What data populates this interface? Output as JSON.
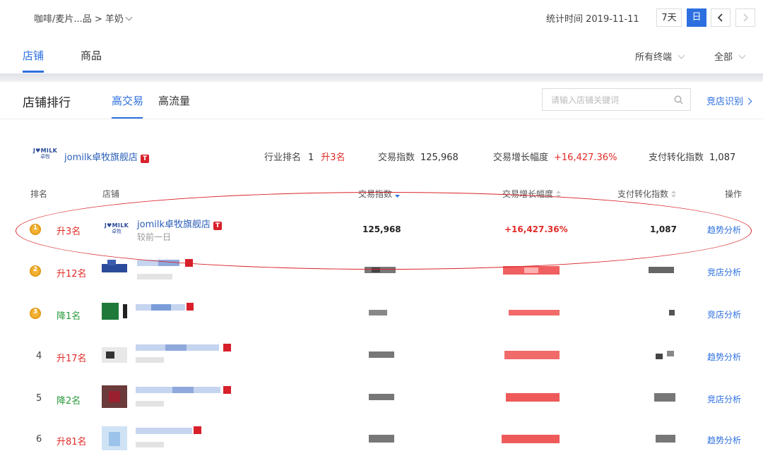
{
  "breadcrumb": "咖啡/麦片...品 > 羊奶",
  "stat_time": "统计时间 2019-11-11",
  "period": {
    "seven_days": "7天",
    "day": "日"
  },
  "main_tabs": [
    "店铺",
    "商品"
  ],
  "filters": {
    "terminal": "所有终端",
    "scope": "全部"
  },
  "panel": {
    "title": "店铺排行",
    "subtabs": [
      "高交易",
      "高流量"
    ],
    "search_placeholder": "请输入店铺关键词",
    "rival_link": "竞店识别"
  },
  "summary": {
    "logo_top": "J♥MILK",
    "logo_bottom": "卓牧",
    "shop_name": "jomilk卓牧旗舰店",
    "tmall_badge": "T",
    "rank_label": "行业排名",
    "rank_value": "1",
    "rank_change": "升3名",
    "trade_label": "交易指数",
    "trade_value": "125,968",
    "growth_label": "交易增长幅度",
    "growth_value": "+16,427.36%",
    "conv_label": "支付转化指数",
    "conv_value": "1,087"
  },
  "table": {
    "headers": [
      "排名",
      "店铺",
      "交易指数",
      "交易增长幅度",
      "支付转化指数",
      "操作"
    ],
    "rows": [
      {
        "rank": "",
        "medal": "1",
        "change": "升3名",
        "dir": "up",
        "shop": "jomilk卓牧旗舰店",
        "sub": "较前一日",
        "trade": "125,968",
        "growth": "+16,427.36%",
        "conv": "1,087",
        "op": "趋势分析"
      },
      {
        "rank": "",
        "medal": "2",
        "change": "升12名",
        "dir": "up",
        "shop": "",
        "sub": "",
        "trade": "",
        "growth": "",
        "conv": "",
        "op": "竞店分析"
      },
      {
        "rank": "",
        "medal": "3",
        "change": "降1名",
        "dir": "down",
        "shop": "",
        "sub": "",
        "trade": "",
        "growth": "",
        "conv": "",
        "op": "竞店分析"
      },
      {
        "rank": "4",
        "medal": "",
        "change": "升17名",
        "dir": "up",
        "shop": "",
        "sub": "",
        "trade": "",
        "growth": "",
        "conv": "",
        "op": "趋势分析"
      },
      {
        "rank": "5",
        "medal": "",
        "change": "降2名",
        "dir": "down",
        "shop": "",
        "sub": "",
        "trade": "",
        "growth": "",
        "conv": "",
        "op": "竞店分析"
      },
      {
        "rank": "6",
        "medal": "",
        "change": "升81名",
        "dir": "up",
        "shop": "",
        "sub": "",
        "trade": "",
        "growth": "",
        "conv": "",
        "op": "趋势分析"
      }
    ]
  },
  "colors": {
    "accent": "#2d6fe0",
    "up": "#e02b27",
    "down": "#2a9a3c",
    "tmall": "#d8202b",
    "highlight_ellipse": "#d9242a"
  }
}
